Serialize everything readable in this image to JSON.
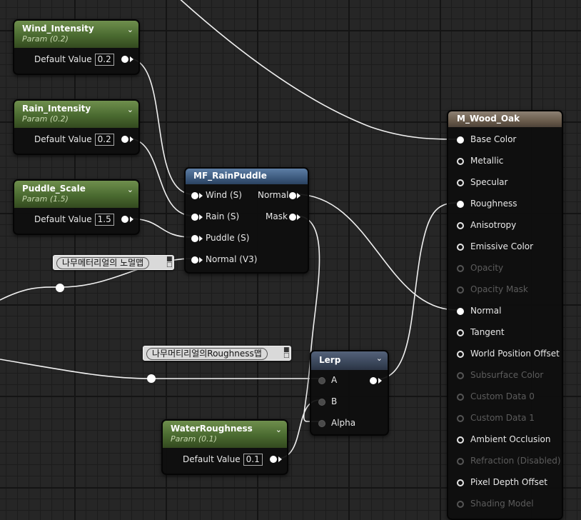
{
  "params": [
    {
      "title": "Wind_Intensity",
      "subtitle": "Param (0.2)",
      "label": "Default Value",
      "value": "0.2"
    },
    {
      "title": "Rain_Intensity",
      "subtitle": "Param (0.2)",
      "label": "Default Value",
      "value": "0.2"
    },
    {
      "title": "Puddle_Scale",
      "subtitle": "Param (1.5)",
      "label": "Default Value",
      "value": "1.5"
    },
    {
      "title": "WaterRoughness",
      "subtitle": "Param (0.1)",
      "label": "Default Value",
      "value": "0.1"
    }
  ],
  "rain_puddle": {
    "title": "MF_RainPuddle",
    "inputs": [
      "Wind (S)",
      "Rain (S)",
      "Puddle (S)",
      "Normal (V3)"
    ],
    "outputs": [
      "Normal",
      "Mask"
    ]
  },
  "lerp": {
    "title": "Lerp",
    "inputs": [
      "A",
      "B",
      "Alpha"
    ]
  },
  "comments": [
    "나무메터리얼의 노멀맵",
    "나무머티리얼의Roughness맵"
  ],
  "material": {
    "title": "M_Wood_Oak",
    "pins": [
      {
        "label": "Base Color",
        "state": "connected"
      },
      {
        "label": "Metallic",
        "state": "open"
      },
      {
        "label": "Specular",
        "state": "open"
      },
      {
        "label": "Roughness",
        "state": "connected"
      },
      {
        "label": "Anisotropy",
        "state": "open"
      },
      {
        "label": "Emissive Color",
        "state": "open"
      },
      {
        "label": "Opacity",
        "state": "disabled"
      },
      {
        "label": "Opacity Mask",
        "state": "disabled"
      },
      {
        "label": "Normal",
        "state": "connected"
      },
      {
        "label": "Tangent",
        "state": "open"
      },
      {
        "label": "World Position Offset",
        "state": "open"
      },
      {
        "label": "Subsurface Color",
        "state": "disabled"
      },
      {
        "label": "Custom Data 0",
        "state": "disabled"
      },
      {
        "label": "Custom Data 1",
        "state": "disabled"
      },
      {
        "label": "Ambient Occlusion",
        "state": "open"
      },
      {
        "label": "Refraction (Disabled)",
        "state": "disabled"
      },
      {
        "label": "Pixel Depth Offset",
        "state": "open"
      },
      {
        "label": "Shading Model",
        "state": "disabled"
      }
    ]
  },
  "icons": {
    "collapse": "chevron-down-icon",
    "comment_pin": "pin-icon"
  },
  "colors": {
    "wire": "#f2f2f2",
    "param_header": "#4a6a30",
    "function_header": "#3d5a7e",
    "material_header": "#6a5c4c"
  }
}
